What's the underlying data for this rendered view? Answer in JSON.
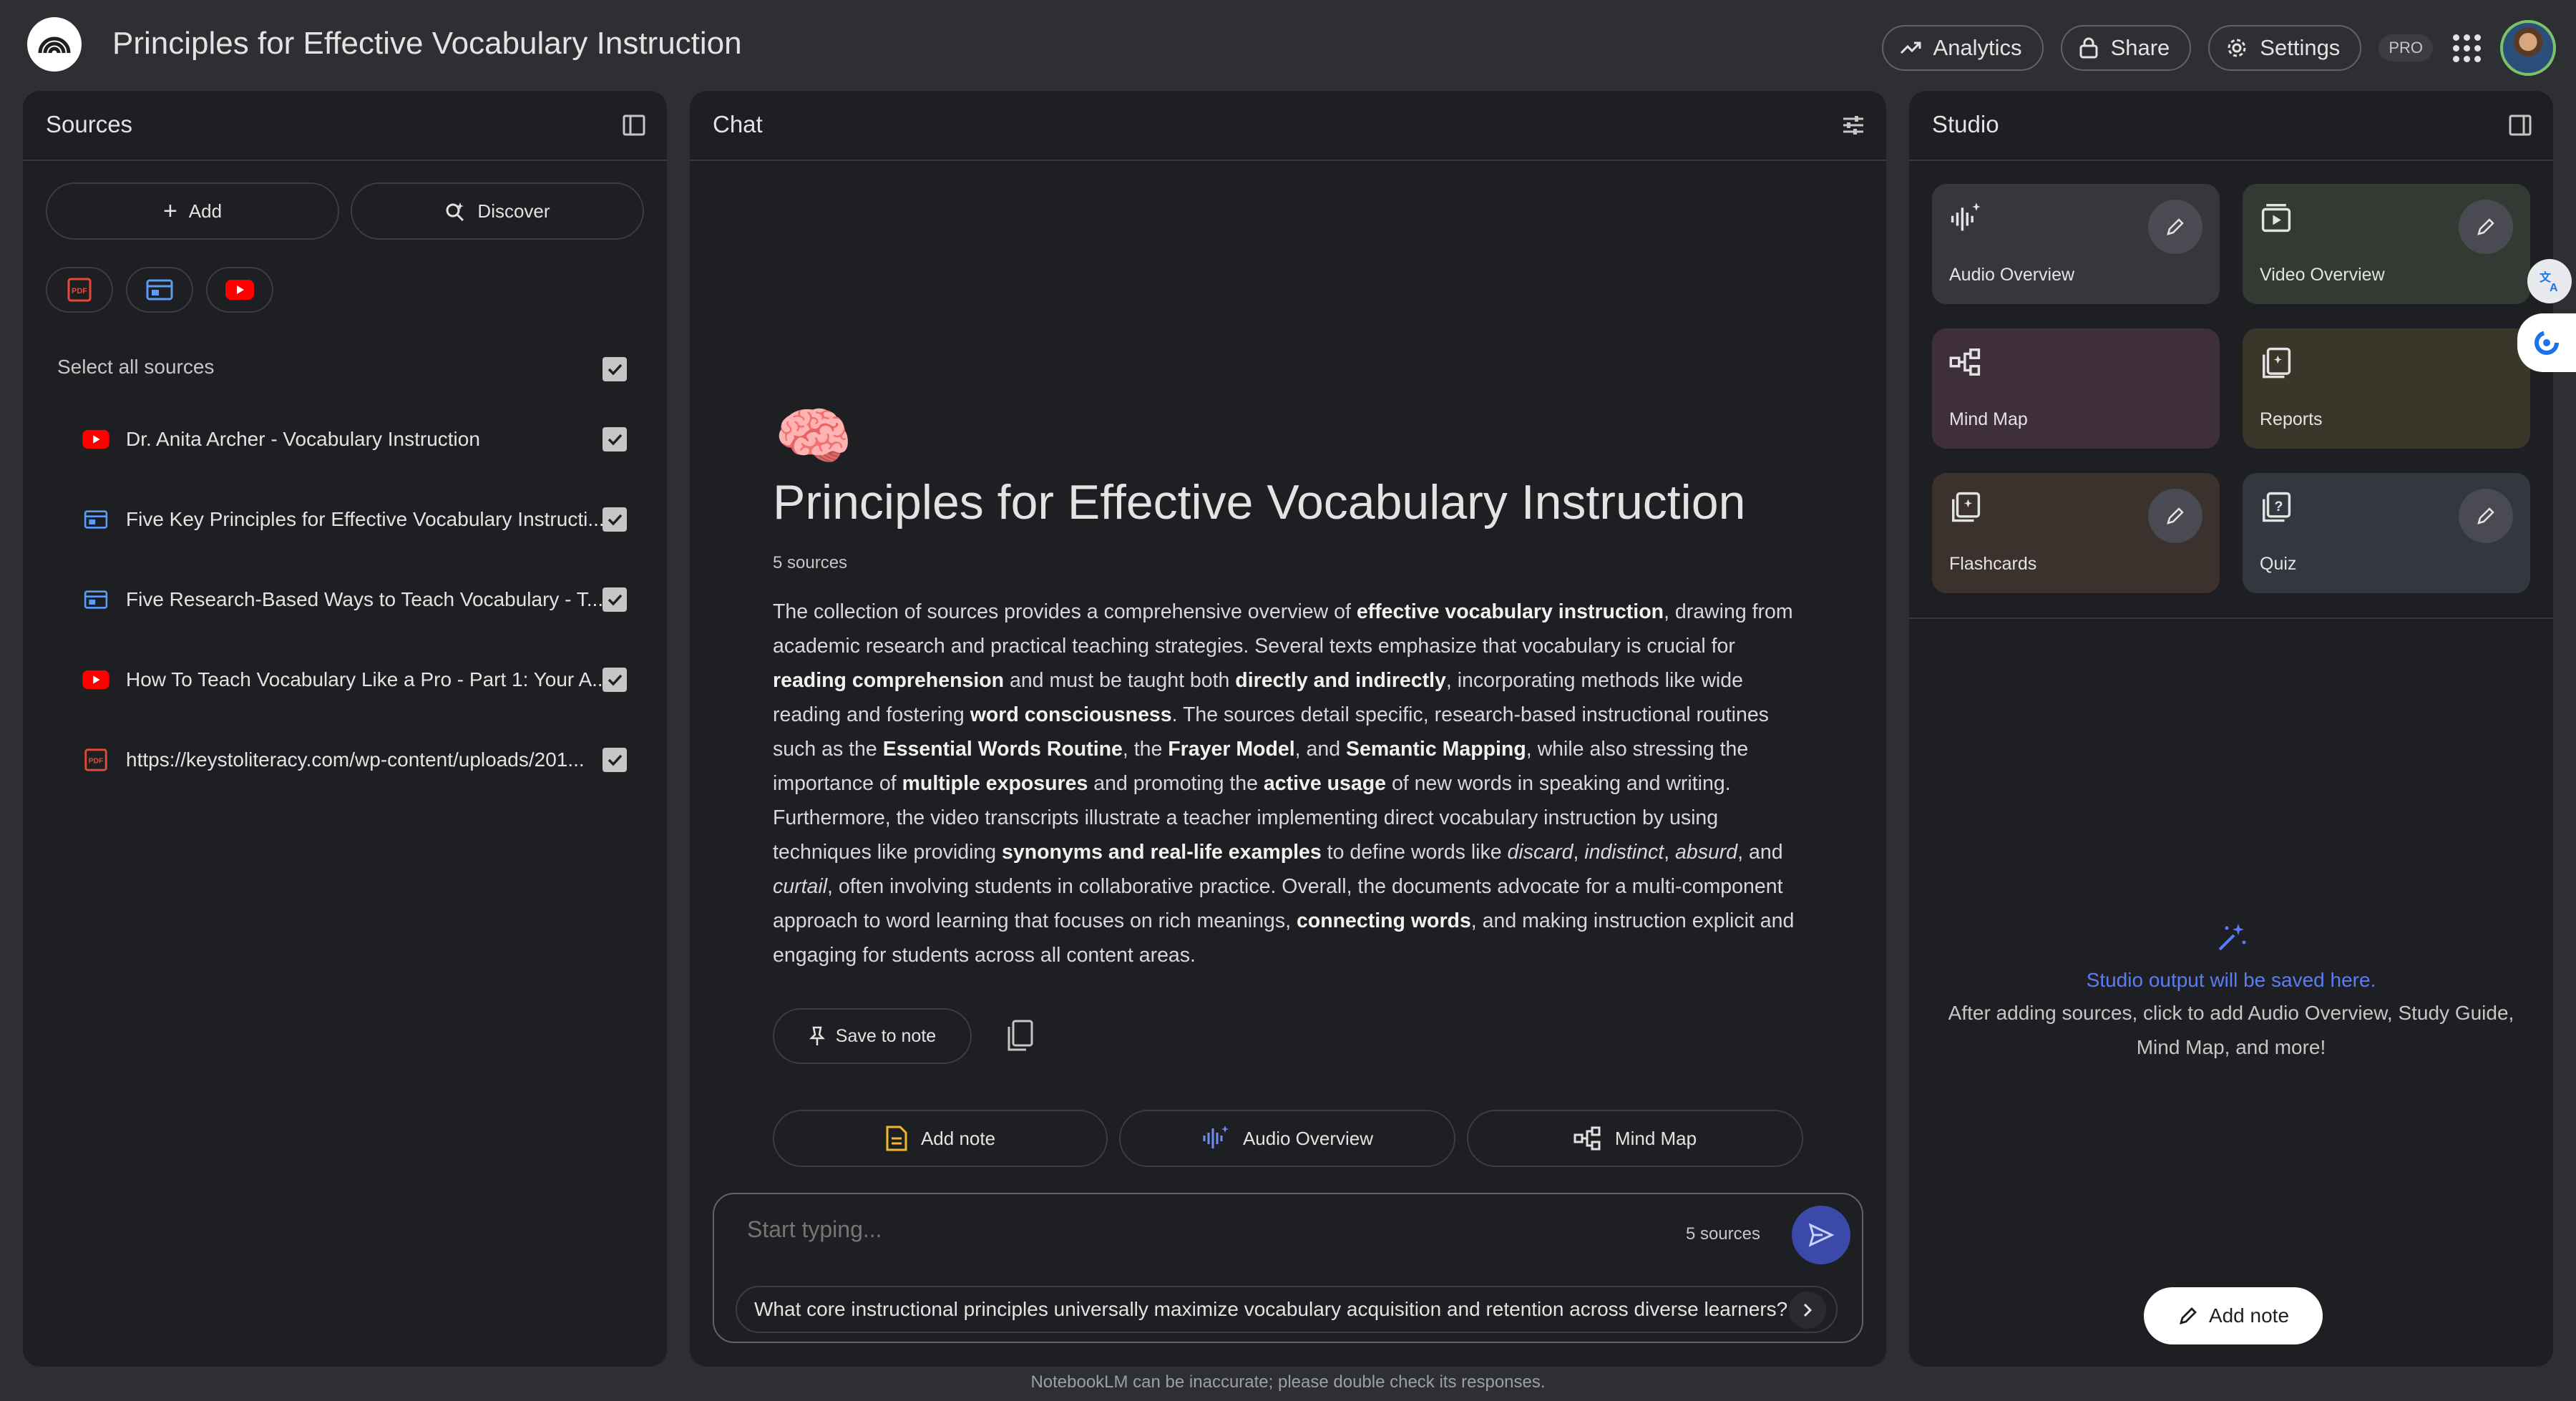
{
  "header": {
    "title": "Principles for Effective Vocabulary Instruction",
    "analytics_label": "Analytics",
    "share_label": "Share",
    "settings_label": "Settings",
    "pro_badge": "PRO"
  },
  "sources": {
    "title": "Sources",
    "add_label": "Add",
    "discover_label": "Discover",
    "filters": [
      "pdf-icon",
      "web-icon",
      "youtube-icon"
    ],
    "select_all_label": "Select all sources",
    "items": [
      {
        "label": "Dr. Anita Archer - Vocabulary Instruction",
        "type": "youtube-icon",
        "checked": true
      },
      {
        "label": "Five Key Principles for Effective Vocabulary Instructi...",
        "type": "web-icon",
        "checked": true
      },
      {
        "label": "Five Research-Based Ways to Teach Vocabulary - T...",
        "type": "web-icon",
        "checked": true
      },
      {
        "label": "How To Teach Vocabulary Like a Pro - Part 1: Your A...",
        "type": "youtube-icon",
        "checked": true
      },
      {
        "label": "https://keystoliteracy.com/wp-content/uploads/201...",
        "type": "pdf-icon",
        "checked": true
      }
    ]
  },
  "chat": {
    "title": "Chat",
    "emoji": "🧠",
    "notebook_title": "Principles for Effective Vocabulary Instruction",
    "source_count": "5 sources",
    "summary_html": "The collection of sources provides a comprehensive overview of <b>effective vocabulary instruction</b>, drawing from academic research and practical teaching strategies. Several texts emphasize that vocabulary is crucial for <b>reading comprehension</b> and must be taught both <b>directly and indirectly</b>, incorporating methods like wide reading and fostering <b>word consciousness</b>. The sources detail specific, research-based instructional routines such as the <b>Essential Words Routine</b>, the <b>Frayer Model</b>, and <b>Semantic Mapping</b>, while also stressing the importance of <b>multiple exposures</b> and promoting the <b>active usage</b> of new words in speaking and writing. Furthermore, the video transcripts illustrate a teacher implementing direct vocabulary instruction by using techniques like providing <b>synonyms and real-life examples</b> to define words like <i>discard</i>, <i>indistinct</i>, <i>absurd</i>, and <i>curtail</i>, often involving students in collaborative practice. Overall, the documents advocate for a multi-component approach to word learning that focuses on rich meanings, <b>connecting words</b>, and making instruction explicit and engaging for students across all content areas.",
    "save_to_note_label": "Save to note",
    "actions": {
      "add_note": "Add note",
      "audio_overview": "Audio Overview",
      "mind_map": "Mind Map"
    },
    "composer_placeholder": "Start typing...",
    "composer_count": "5 sources",
    "suggestion": "What core instructional principles universally maximize vocabulary acquisition and retention across diverse learners?",
    "disclaimer": "NotebookLM can be inaccurate; please double check its responses."
  },
  "studio": {
    "title": "Studio",
    "tiles": {
      "audio_overview": "Audio Overview",
      "video_overview": "Video Overview",
      "mind_map": "Mind Map",
      "reports": "Reports",
      "flashcards": "Flashcards",
      "quiz": "Quiz"
    },
    "empty_title": "Studio output will be saved here.",
    "empty_desc": "After adding sources, click to add Audio Overview, Study Guide, Mind Map, and more!",
    "add_note_label": "Add note"
  },
  "colors": {
    "background": "#2e2f33",
    "panel": "#1e1f22",
    "accent": "#5b7cf5",
    "tile_audio": "#35373d",
    "tile_video": "#333a33",
    "tile_mindmap": "#3e2f3a",
    "tile_reports": "#3a3629",
    "tile_flashcards": "#3b312d",
    "tile_quiz": "#33373f"
  }
}
